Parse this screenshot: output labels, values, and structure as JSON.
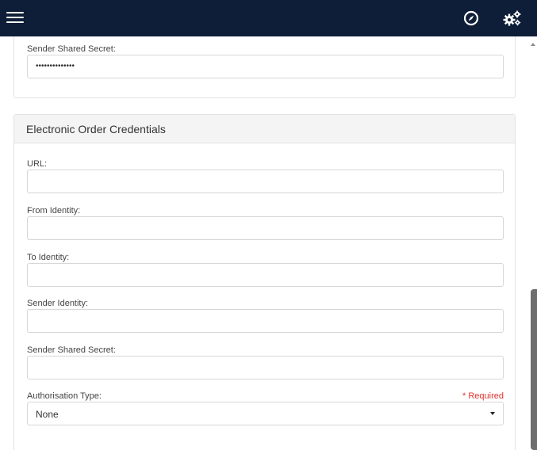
{
  "top_section": {
    "secret_label": "Sender Shared Secret:",
    "secret_value": "••••••••••••••"
  },
  "electronic_order": {
    "title": "Electronic Order Credentials",
    "fields": [
      {
        "label": "URL:",
        "value": ""
      },
      {
        "label": "From Identity:",
        "value": ""
      },
      {
        "label": "To Identity:",
        "value": ""
      },
      {
        "label": "Sender Identity:",
        "value": ""
      },
      {
        "label": "Sender Shared Secret:",
        "value": ""
      }
    ],
    "auth_label": "Authorisation Type:",
    "auth_required": "* Required",
    "auth_value": "None"
  },
  "icons": {
    "menu": "hamburger-menu-icon",
    "compass": "compass-icon",
    "settings": "gears-icon"
  },
  "colors": {
    "topbar": "#0f1e38",
    "required": "#e0302b"
  }
}
